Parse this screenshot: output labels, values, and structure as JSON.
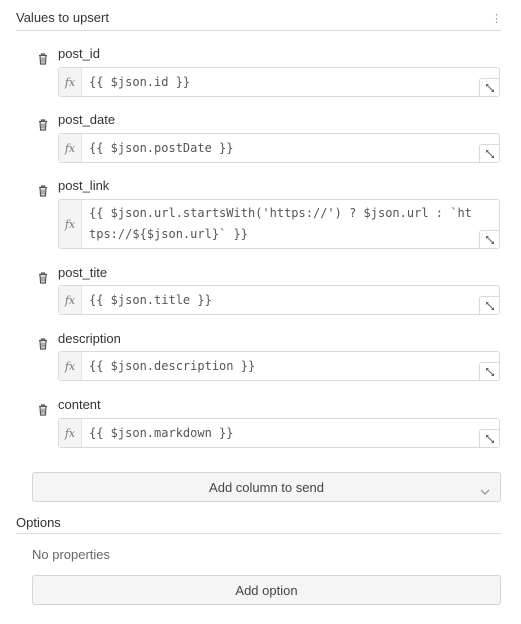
{
  "values_section": {
    "title": "Values to upsert",
    "menu_icon": "kebab-icon"
  },
  "fields": [
    {
      "label": "post_id",
      "expression": "{{ $json.id }}"
    },
    {
      "label": "post_date",
      "expression": "{{ $json.postDate }}"
    },
    {
      "label": "post_link",
      "expression": "{{ $json.url.startsWith('https://') ? $json.url : `https://${$json.url}` }}"
    },
    {
      "label": "post_tite",
      "expression": "{{ $json.title }}"
    },
    {
      "label": "description",
      "expression": "{{ $json.description }}"
    },
    {
      "label": "content",
      "expression": "{{ $json.markdown }}"
    }
  ],
  "fx_symbol": "fx",
  "add_column": {
    "label": "Add column to send",
    "icon": "chevron-down-icon"
  },
  "options_section": {
    "title": "Options",
    "empty_text": "No properties",
    "add_label": "Add option"
  },
  "colors": {
    "border": "#d9d9d9",
    "button_bg": "#f5f5f5",
    "text": "#333333"
  }
}
